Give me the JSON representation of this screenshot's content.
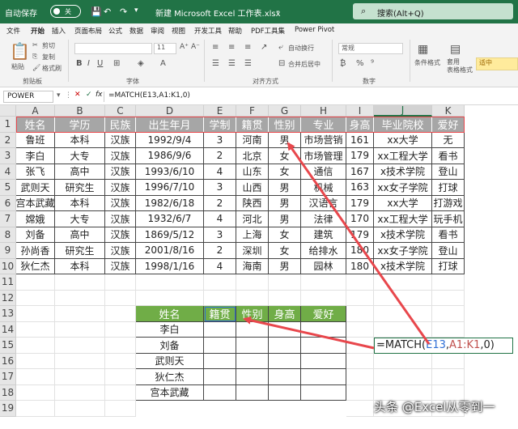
{
  "titlebar": {
    "autosave_label": "自动保存",
    "autosave_state": "关",
    "filename": "新建 Microsoft Excel 工作表.xlsx",
    "search_placeholder": "搜索(Alt+Q)",
    "bg_color": "#217346"
  },
  "tabs": [
    "文件",
    "开始",
    "插入",
    "页面布局",
    "公式",
    "数据",
    "审阅",
    "视图",
    "开发工具",
    "帮助",
    "PDF工具集",
    "Power Pivot"
  ],
  "active_tab": "开始",
  "ribbon": {
    "clipboard": {
      "paste": "粘贴",
      "cut": "剪切",
      "copy": "复制",
      "format_painter": "格式刷",
      "group": "剪贴板"
    },
    "font": {
      "name_value": "",
      "size_value": "11",
      "group": "字体"
    },
    "alignment": {
      "wrap": "自动换行",
      "merge": "合并后居中",
      "group": "对齐方式"
    },
    "number": {
      "format": "常规",
      "group": "数字"
    },
    "styles": {
      "conditional": "条件格式",
      "table": "套用\n表格格式",
      "cell_style": "适中"
    },
    "accent_color": "#217346"
  },
  "formula_bar": {
    "name_box": "POWER",
    "fx": "fx",
    "formula": "=MATCH(E13,A1:K1,0)"
  },
  "sheet": {
    "columns": [
      "A",
      "B",
      "C",
      "D",
      "E",
      "F",
      "G",
      "H",
      "I",
      "J",
      "K"
    ],
    "row_numbers": [
      "1",
      "2",
      "3",
      "4",
      "5",
      "6",
      "7",
      "8",
      "9",
      "10",
      "11",
      "12",
      "13",
      "14",
      "15",
      "16",
      "17",
      "18",
      "19"
    ],
    "header_row": [
      "姓名",
      "学历",
      "民族",
      "出生年月",
      "学制",
      "籍贯",
      "性别",
      "专业",
      "身高",
      "毕业院校",
      "爱好"
    ],
    "rows": [
      [
        "鲁班",
        "本科",
        "汉族",
        "1992/9/4",
        "3",
        "河南",
        "男",
        "市场营销",
        "161",
        "xx大学",
        "无"
      ],
      [
        "李白",
        "大专",
        "汉族",
        "1986/9/6",
        "2",
        "北京",
        "女",
        "市场管理",
        "179",
        "xx工程大学",
        "看书"
      ],
      [
        "张飞",
        "高中",
        "汉族",
        "1993/6/10",
        "4",
        "山东",
        "女",
        "通信",
        "167",
        "x技术学院",
        "登山"
      ],
      [
        "武则天",
        "研究生",
        "汉族",
        "1996/7/10",
        "3",
        "山西",
        "男",
        "机械",
        "163",
        "xx女子学院",
        "打球"
      ],
      [
        "宫本武藏",
        "本科",
        "汉族",
        "1982/6/18",
        "2",
        "陕西",
        "男",
        "汉语言",
        "179",
        "xx大学",
        "打游戏"
      ],
      [
        "嫦娥",
        "大专",
        "汉族",
        "1932/6/7",
        "4",
        "河北",
        "男",
        "法律",
        "170",
        "xx工程大学",
        "玩手机"
      ],
      [
        "刘备",
        "高中",
        "汉族",
        "1869/5/12",
        "3",
        "上海",
        "女",
        "建筑",
        "179",
        "x技术学院",
        "看书"
      ],
      [
        "孙尚香",
        "研究生",
        "汉族",
        "2001/8/16",
        "2",
        "深圳",
        "女",
        "给排水",
        "180",
        "xx女子学院",
        "登山"
      ],
      [
        "狄仁杰",
        "本科",
        "汉族",
        "1998/1/16",
        "4",
        "海南",
        "男",
        "园林",
        "180",
        "x技术学院",
        "打球"
      ]
    ],
    "lookup_header": [
      "姓名",
      "籍贯",
      "性别",
      "身高",
      "爱好"
    ],
    "lookup_names": [
      "李白",
      "刘备",
      "武则天",
      "狄仁杰",
      "宫本武藏"
    ],
    "formula_in_cell": {
      "prefix": "=MATCH(",
      "ref1": "E13",
      "comma": ",",
      "ref2": "A1:K1",
      "suffix": ",0)"
    },
    "header_fill": "#a6a6a6",
    "lookup_fill": "#70ad47",
    "arrow_color": "#e8474c"
  },
  "watermark": "头条 @Excel从零到一"
}
